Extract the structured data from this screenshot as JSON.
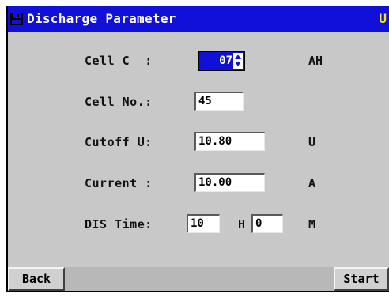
{
  "window": {
    "title": "Discharge Parameter",
    "title_right": "U"
  },
  "form": {
    "cell_capacity": {
      "label": "Cell C  :",
      "value": "07",
      "unit": "AH"
    },
    "cell_number": {
      "label": "Cell No.:",
      "value": "45"
    },
    "cutoff_voltage": {
      "label": "Cutoff U:",
      "value": "10.80",
      "unit": "U"
    },
    "current": {
      "label": "Current :",
      "value": "10.00",
      "unit": "A"
    },
    "discharge_time": {
      "label": "DIS Time:",
      "hours_value": "10",
      "hours_unit": "H",
      "minutes_value": "0",
      "minutes_unit": "M"
    }
  },
  "buttons": {
    "back": "Back",
    "start": "Start"
  },
  "colors": {
    "titlebar": "#1010d8",
    "window_bg": "#c8c8c8",
    "title_accent": "#ffe800"
  },
  "icons": {
    "title_icon": "save-icon",
    "spinner": "spin-arrows-icon"
  }
}
